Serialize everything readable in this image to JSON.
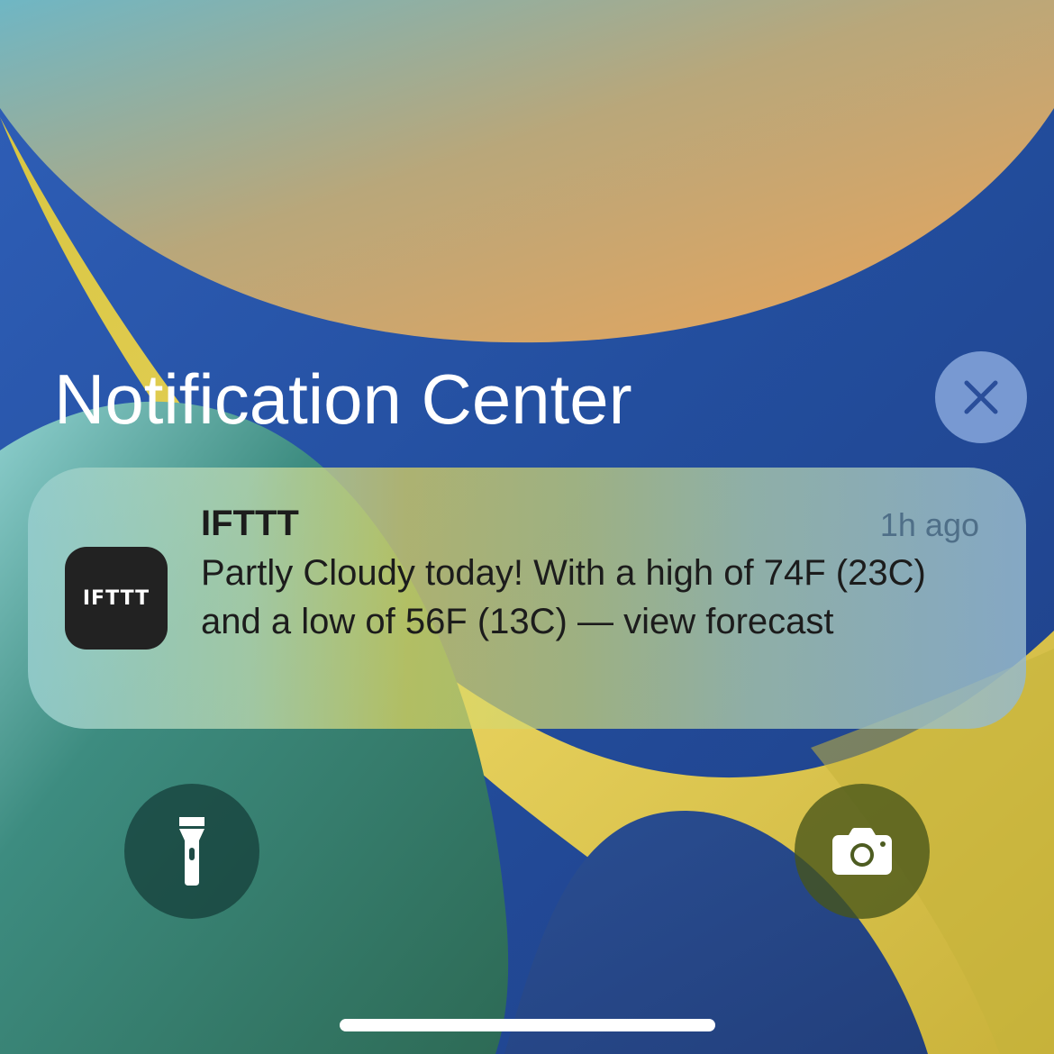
{
  "header": {
    "title": "Notification Center",
    "close_icon": "close-icon"
  },
  "notification": {
    "app_icon_text": "IFTTT",
    "app_name": "IFTTT",
    "time": "1h ago",
    "body": "Partly Cloudy today! With a high of 74F (23C) and a low of 56F (13C) — view forecast"
  },
  "quick_actions": {
    "flashlight_icon": "flashlight-icon",
    "camera_icon": "camera-icon"
  },
  "colors": {
    "wallpaper_blue": "#2a5cb0",
    "wallpaper_orange": "#e8a65a",
    "wallpaper_yellow": "#e4c841",
    "wallpaper_green": "#2e6a5a",
    "card_text": "#1c1c1c",
    "time_text": "#4f6f88"
  }
}
